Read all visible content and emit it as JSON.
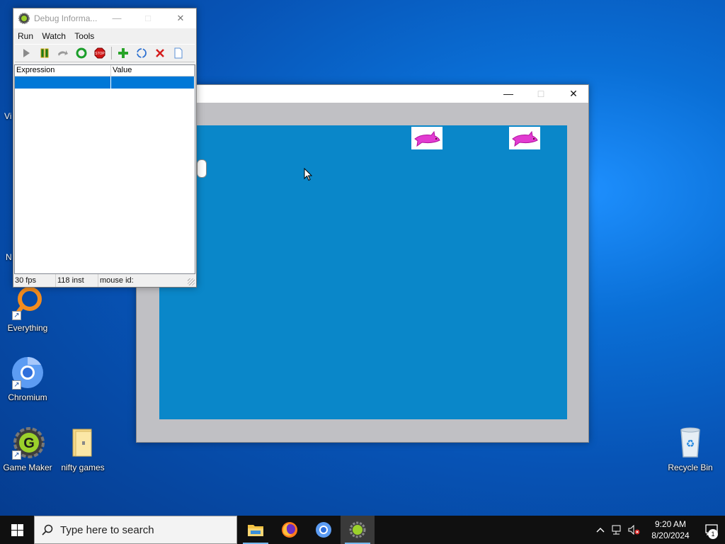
{
  "desktop": {
    "icons": [
      {
        "label": "Everything"
      },
      {
        "label": "Chromium"
      },
      {
        "label": "Game Maker"
      },
      {
        "label": "nifty games"
      },
      {
        "label": "Recycle Bin"
      }
    ],
    "partial_labels": [
      "Vi",
      "N"
    ]
  },
  "debug_window": {
    "title": "Debug Informa...",
    "menu": [
      "Run",
      "Watch",
      "Tools"
    ],
    "toolbar": [
      "run-icon",
      "pause-icon",
      "step-icon",
      "restart-icon",
      "stop-icon",
      "add-watch-icon",
      "refresh-icon",
      "delete-watch-icon",
      "clear-icon"
    ],
    "columns": [
      "Expression",
      "Value"
    ],
    "status": {
      "fps": "30 fps",
      "instances": "118 inst",
      "mouse": "mouse id:"
    }
  },
  "game_window": {
    "sprites": [
      "shark-icon",
      "shark-icon",
      "troll-face-icon"
    ],
    "room_color": "#0a87c9"
  },
  "taskbar": {
    "search_placeholder": "Type here to search",
    "apps": [
      "file-explorer-icon",
      "firefox-icon",
      "chromium-icon",
      "game-maker-icon"
    ],
    "clock_time": "9:20 AM",
    "clock_date": "8/20/2024",
    "notification_count": "1"
  }
}
